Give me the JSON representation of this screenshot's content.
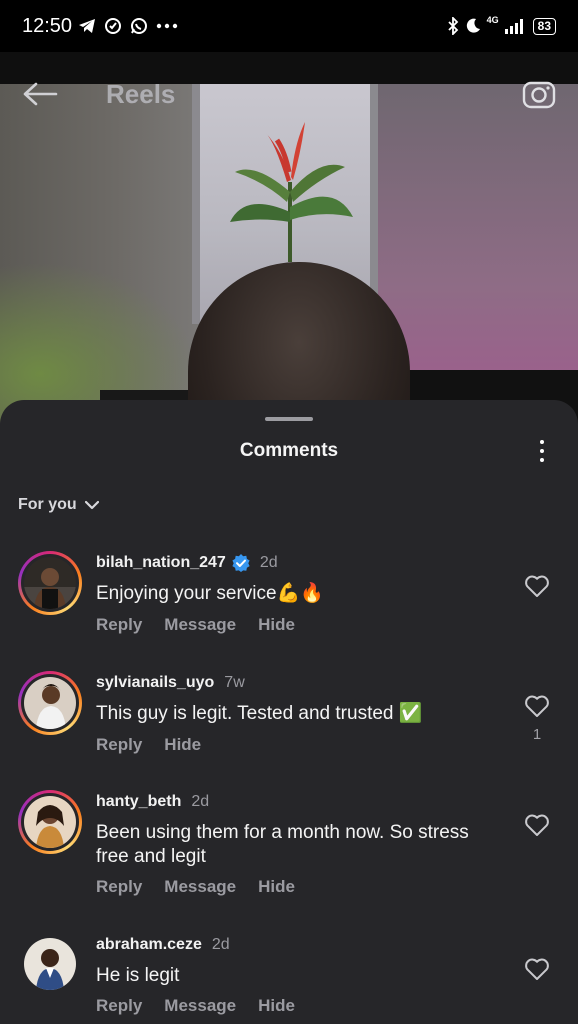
{
  "status_bar": {
    "time": "12:50",
    "network": "4G",
    "battery": "83",
    "left_icons": [
      "telegram-icon",
      "settings-icon",
      "whatsapp-icon",
      "more-dots-icon"
    ],
    "right_icons": [
      "bluetooth-icon",
      "moon-icon",
      "signal-icon",
      "battery-icon"
    ]
  },
  "reel_header": {
    "title": "Reels"
  },
  "comments_sheet": {
    "title": "Comments",
    "filter_label": "For you",
    "comments": [
      {
        "username": "bilah_nation_247",
        "verified": true,
        "time": "2d",
        "text": "Enjoying your service💪🔥",
        "actions": [
          "Reply",
          "Message",
          "Hide"
        ],
        "likes": ""
      },
      {
        "username": "sylvianails_uyo",
        "verified": false,
        "time": "7w",
        "text": "This guy is legit. Tested and trusted ✅",
        "actions": [
          "Reply",
          "Hide"
        ],
        "likes": "1"
      },
      {
        "username": "hanty_beth",
        "verified": false,
        "time": "2d",
        "text": "Been using them for a month now. So stress free and legit",
        "actions": [
          "Reply",
          "Message",
          "Hide"
        ],
        "likes": ""
      },
      {
        "username": "abraham.ceze",
        "verified": false,
        "time": "2d",
        "text": "He is legit",
        "actions": [
          "Reply",
          "Message",
          "Hide"
        ],
        "likes": ""
      }
    ]
  },
  "colors": {
    "sheet_bg": "#262629",
    "muted_text": "#9b9ba1",
    "verified_blue": "#3797f0",
    "story_ring": "#d62976"
  }
}
